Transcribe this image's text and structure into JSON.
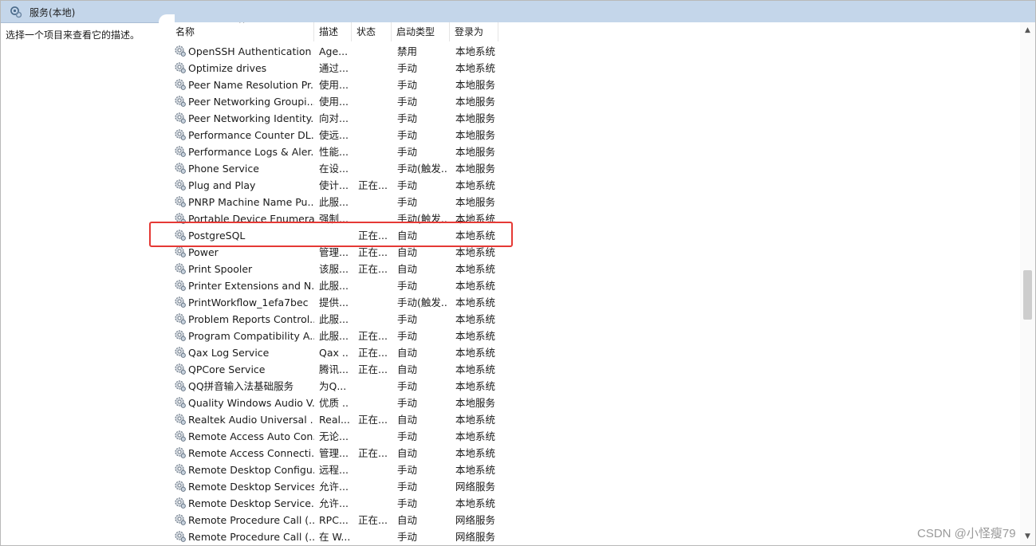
{
  "window": {
    "title": "服务(本地)"
  },
  "left_pane": {
    "description_hint": "选择一个项目来查看它的描述。"
  },
  "columns": {
    "name": "名称",
    "description": "描述",
    "status": "状态",
    "startup_type": "启动类型",
    "logon_as": "登录为"
  },
  "services": [
    {
      "name": "OpenSSH Authentication ...",
      "description": "Age...",
      "status": "",
      "startup_type": "禁用",
      "logon_as": "本地系统"
    },
    {
      "name": "Optimize drives",
      "description": "通过...",
      "status": "",
      "startup_type": "手动",
      "logon_as": "本地系统"
    },
    {
      "name": "Peer Name Resolution Pr...",
      "description": "使用...",
      "status": "",
      "startup_type": "手动",
      "logon_as": "本地服务"
    },
    {
      "name": "Peer Networking Groupi...",
      "description": "使用...",
      "status": "",
      "startup_type": "手动",
      "logon_as": "本地服务"
    },
    {
      "name": "Peer Networking Identity...",
      "description": "向对...",
      "status": "",
      "startup_type": "手动",
      "logon_as": "本地服务"
    },
    {
      "name": "Performance Counter DL...",
      "description": "使远...",
      "status": "",
      "startup_type": "手动",
      "logon_as": "本地服务"
    },
    {
      "name": "Performance Logs & Aler...",
      "description": "性能...",
      "status": "",
      "startup_type": "手动",
      "logon_as": "本地服务"
    },
    {
      "name": "Phone Service",
      "description": "在设...",
      "status": "",
      "startup_type": "手动(触发...",
      "logon_as": "本地服务"
    },
    {
      "name": "Plug and Play",
      "description": "使计...",
      "status": "正在...",
      "startup_type": "手动",
      "logon_as": "本地系统"
    },
    {
      "name": "PNRP Machine Name Pu...",
      "description": "此服...",
      "status": "",
      "startup_type": "手动",
      "logon_as": "本地服务"
    },
    {
      "name": "Portable Device Enumera...",
      "description": "强制...",
      "status": "",
      "startup_type": "手动(触发...",
      "logon_as": "本地系统"
    },
    {
      "name": "PostgreSQL",
      "description": "",
      "status": "正在...",
      "startup_type": "自动",
      "logon_as": "本地系统"
    },
    {
      "name": "Power",
      "description": "管理...",
      "status": "正在...",
      "startup_type": "自动",
      "logon_as": "本地系统"
    },
    {
      "name": "Print Spooler",
      "description": "该服...",
      "status": "正在...",
      "startup_type": "自动",
      "logon_as": "本地系统"
    },
    {
      "name": "Printer Extensions and N...",
      "description": "此服...",
      "status": "",
      "startup_type": "手动",
      "logon_as": "本地系统"
    },
    {
      "name": "PrintWorkflow_1efa7bec",
      "description": "提供...",
      "status": "",
      "startup_type": "手动(触发...",
      "logon_as": "本地系统"
    },
    {
      "name": "Problem Reports Control...",
      "description": "此服...",
      "status": "",
      "startup_type": "手动",
      "logon_as": "本地系统"
    },
    {
      "name": "Program Compatibility A...",
      "description": "此服...",
      "status": "正在...",
      "startup_type": "手动",
      "logon_as": "本地系统"
    },
    {
      "name": "Qax Log Service",
      "description": "Qax ...",
      "status": "正在...",
      "startup_type": "自动",
      "logon_as": "本地系统"
    },
    {
      "name": "QPCore Service",
      "description": "腾讯...",
      "status": "正在...",
      "startup_type": "自动",
      "logon_as": "本地系统"
    },
    {
      "name": "QQ拼音输入法基础服务",
      "description": "为Q...",
      "status": "",
      "startup_type": "手动",
      "logon_as": "本地系统"
    },
    {
      "name": "Quality Windows Audio V...",
      "description": "优质 ...",
      "status": "",
      "startup_type": "手动",
      "logon_as": "本地服务"
    },
    {
      "name": "Realtek Audio Universal ...",
      "description": "Real...",
      "status": "正在...",
      "startup_type": "自动",
      "logon_as": "本地系统"
    },
    {
      "name": "Remote Access Auto Con...",
      "description": "无论...",
      "status": "",
      "startup_type": "手动",
      "logon_as": "本地系统"
    },
    {
      "name": "Remote Access Connecti...",
      "description": "管理...",
      "status": "正在...",
      "startup_type": "自动",
      "logon_as": "本地系统"
    },
    {
      "name": "Remote Desktop Configu...",
      "description": "远程...",
      "status": "",
      "startup_type": "手动",
      "logon_as": "本地系统"
    },
    {
      "name": "Remote Desktop Services",
      "description": "允许...",
      "status": "",
      "startup_type": "手动",
      "logon_as": "网络服务"
    },
    {
      "name": "Remote Desktop Service...",
      "description": "允许...",
      "status": "",
      "startup_type": "手动",
      "logon_as": "本地系统"
    },
    {
      "name": "Remote Procedure Call (...",
      "description": "RPC...",
      "status": "正在...",
      "startup_type": "自动",
      "logon_as": "网络服务"
    },
    {
      "name": "Remote Procedure Call (...",
      "description": "在 W...",
      "status": "",
      "startup_type": "手动",
      "logon_as": "网络服务"
    }
  ],
  "highlight": {
    "color": "#e53935"
  },
  "watermark": "CSDN @小怪瘦79"
}
